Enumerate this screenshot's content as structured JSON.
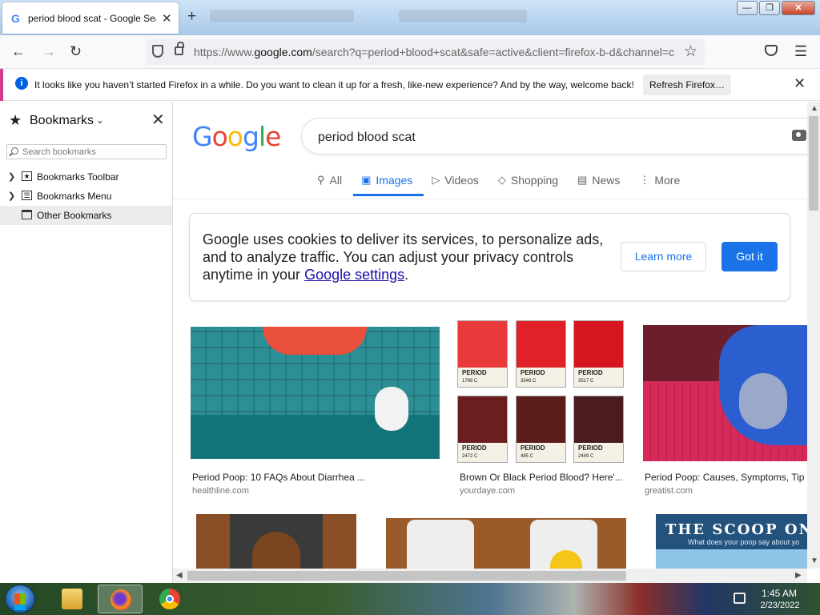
{
  "browser": {
    "tab_title": "period blood scat - Google Sear",
    "tab_favicon": "G",
    "tab_close": "✕",
    "new_tab": "+",
    "url_prefix": "https://www.",
    "url_host": "google.com",
    "url_rest": "/search?q=period+blood+scat&safe=active&client=firefox-b-d&channel=c",
    "window_buttons": [
      "—",
      "❐",
      "✕"
    ]
  },
  "notification": {
    "text": "It looks like you haven’t started Firefox in a while. Do you want to clean it up for a fresh, like-new experience? And by the way, welcome back!",
    "button": "Refresh Firefox…"
  },
  "sidebar": {
    "title": "Bookmarks",
    "search_placeholder": "Search bookmarks",
    "items": [
      {
        "label": "Bookmarks Toolbar"
      },
      {
        "label": "Bookmarks Menu"
      },
      {
        "label": "Other Bookmarks"
      }
    ]
  },
  "google": {
    "logo": [
      "G",
      "o",
      "o",
      "g",
      "l",
      "e"
    ],
    "query": "period blood scat",
    "tabs": [
      {
        "label": "All",
        "icon": "search-icon"
      },
      {
        "label": "Images",
        "icon": "image-icon"
      },
      {
        "label": "Videos",
        "icon": "play-icon"
      },
      {
        "label": "Shopping",
        "icon": "tag-icon"
      },
      {
        "label": "News",
        "icon": "news-icon"
      },
      {
        "label": "More",
        "icon": "more-icon"
      }
    ],
    "cookie_text": "Google uses cookies to deliver its services, to personalize ads, and to analyze traffic. You can adjust your privacy controls anytime in your ",
    "cookie_link": "Google settings",
    "cookie_end": ".",
    "learn_more": "Learn more",
    "got_it": "Got it",
    "results": [
      {
        "title": "Period Poop: 10 FAQs About Diarrhea ...",
        "site": "healthline.com"
      },
      {
        "title": "Brown Or Black Period Blood? Here'...",
        "site": "yourdaye.com"
      },
      {
        "title": "Period Poop: Causes, Symptoms, Tip",
        "site": "greatist.com"
      }
    ],
    "swatches": [
      {
        "name": "PERIOD",
        "code": "1788 C",
        "color": "#e8393b"
      },
      {
        "name": "PERIOD",
        "code": "3546 C",
        "color": "#e02127"
      },
      {
        "name": "PERIOD",
        "code": "3517 C",
        "color": "#d4161f"
      },
      {
        "name": "PERIOD",
        "code": "2472 C",
        "color": "#6a1e1f"
      },
      {
        "name": "PERIOD",
        "code": "485 C",
        "color": "#5a1d1a"
      },
      {
        "name": "PERIOD",
        "code": "2449 C",
        "color": "#4a1b1f"
      }
    ],
    "scoop_title": "THE SCOOP ON",
    "scoop_sub": "What does your poop say about yo"
  },
  "taskbar": {
    "time": "1:45 AM",
    "date": "2/23/2022"
  }
}
